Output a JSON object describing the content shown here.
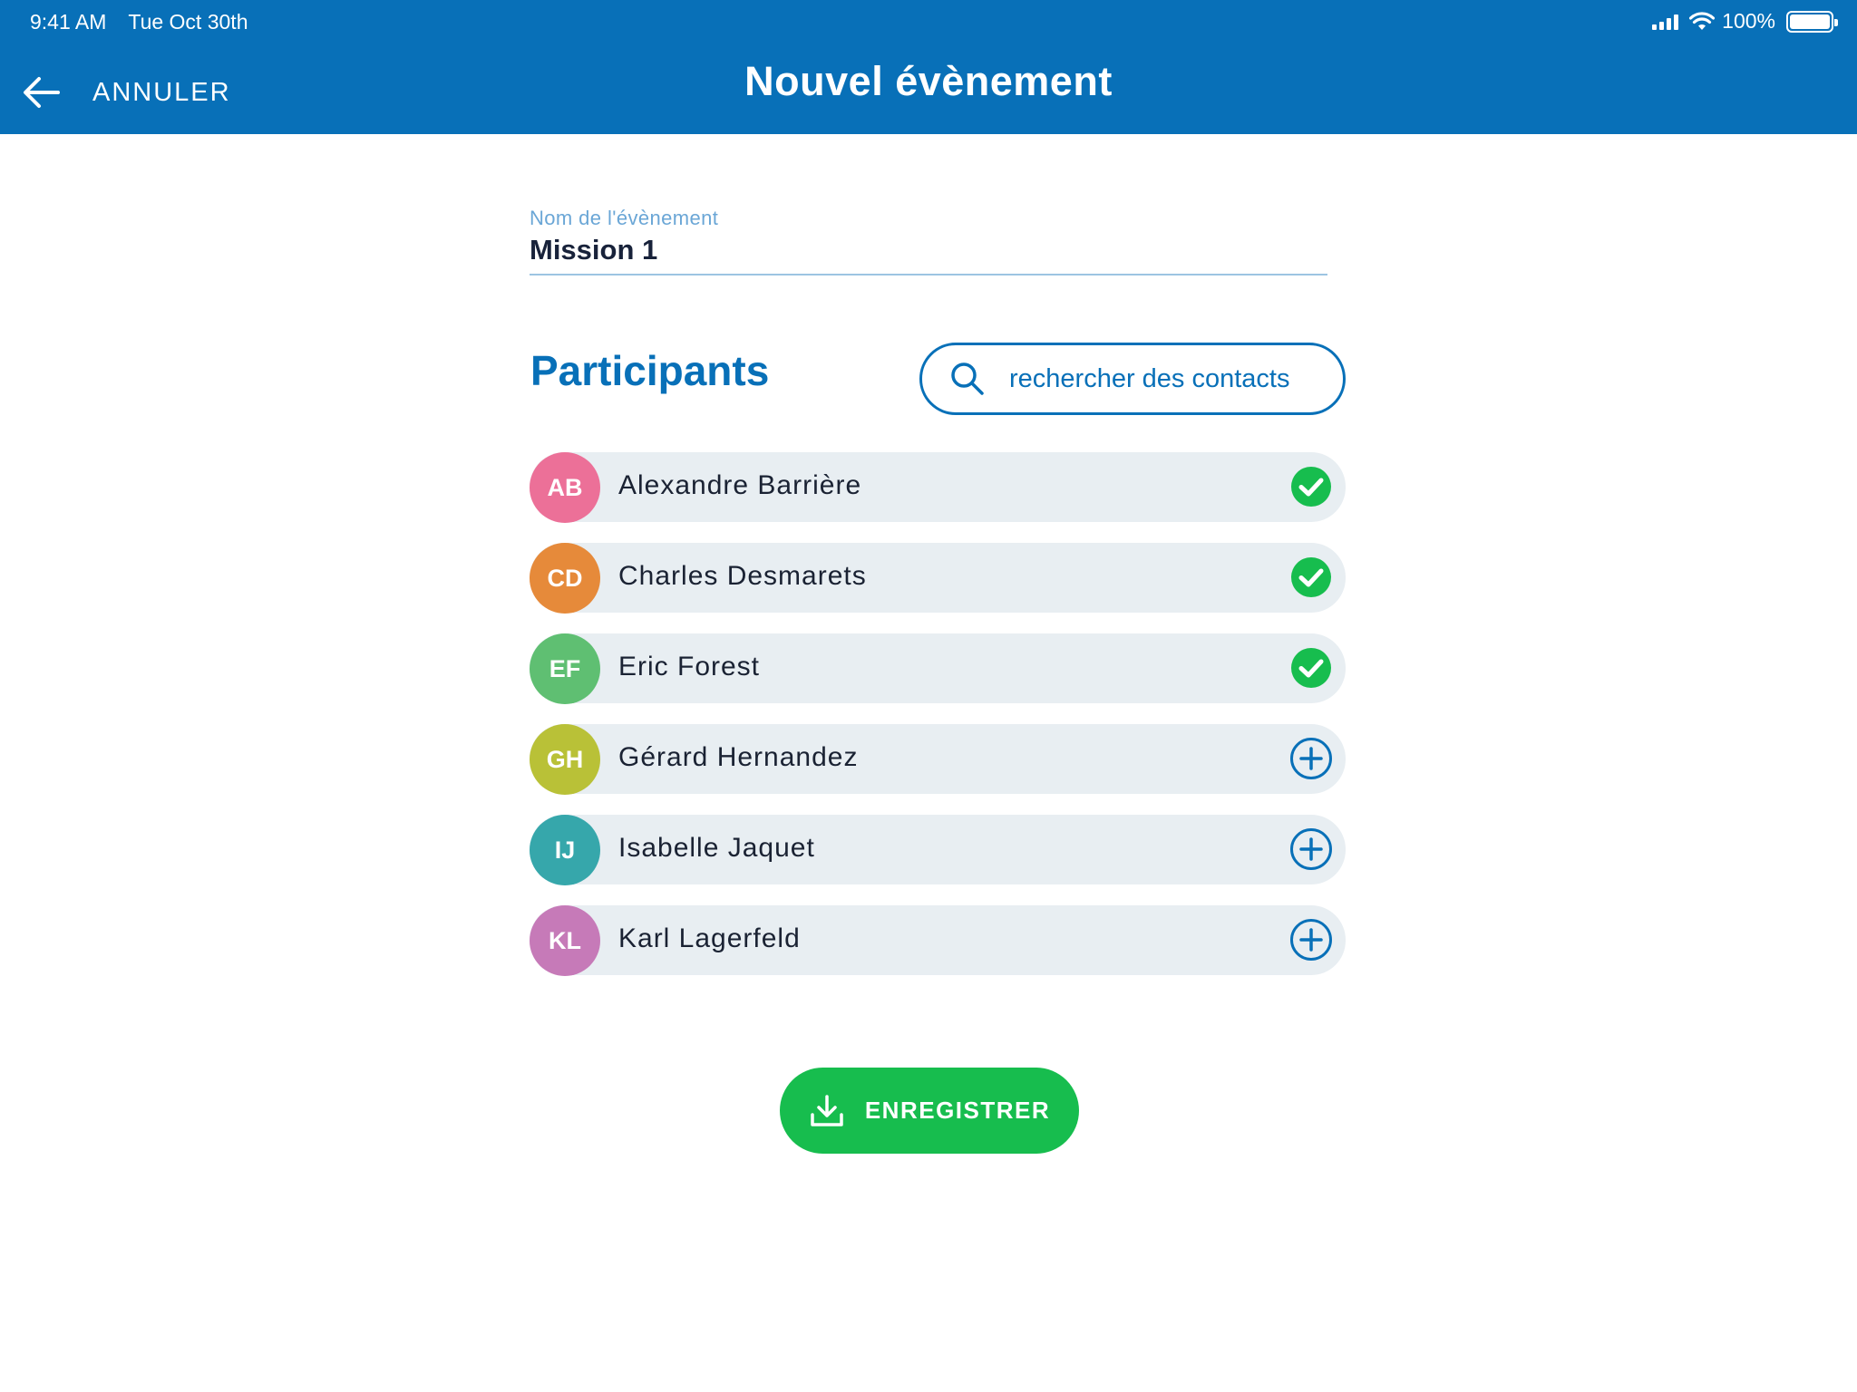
{
  "status_bar": {
    "time": "9:41 AM",
    "date": "Tue Oct 30th",
    "battery": "100%"
  },
  "header": {
    "back_label": "ANNULER",
    "title": "Nouvel évènement"
  },
  "event_name": {
    "label": "Nom de l'évènement",
    "value": "Mission 1"
  },
  "participants": {
    "title": "Participants",
    "search_label": "rechercher des contacts",
    "items": [
      {
        "initials": "AB",
        "name": "Alexandre Barrière",
        "color": "#ec7098",
        "status": "added"
      },
      {
        "initials": "CD",
        "name": "Charles Desmarets",
        "color": "#e68a3a",
        "status": "added"
      },
      {
        "initials": "EF",
        "name": "Eric Forest",
        "color": "#5fbf72",
        "status": "added"
      },
      {
        "initials": "GH",
        "name": "Gérard Hernandez",
        "color": "#b9c137",
        "status": "add"
      },
      {
        "initials": "IJ",
        "name": "Isabelle Jaquet",
        "color": "#36a7ab",
        "status": "add"
      },
      {
        "initials": "KL",
        "name": "Karl Lagerfeld",
        "color": "#c67ab8",
        "status": "add"
      }
    ]
  },
  "save_button": {
    "label": "ENREGISTRER"
  },
  "colors": {
    "primary": "#0870b8",
    "success": "#17bd4e",
    "row_bg": "#e8eef2"
  }
}
